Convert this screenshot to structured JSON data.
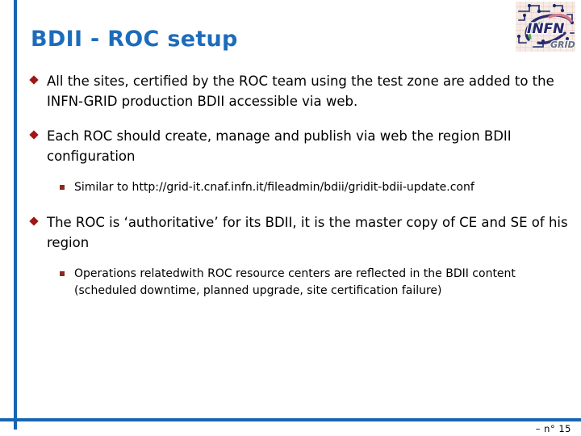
{
  "slide": {
    "title": "BDII - ROC setup",
    "background_color": "#ffffff",
    "accent_color": "#1565b0",
    "title_color": "#1d6cbb",
    "bullet_color": "#9e1616",
    "subbullet_color": "#8a2a1c"
  },
  "logo": {
    "name": "infn-grid-logo",
    "primary_text": "INFN",
    "secondary_text": "GRID",
    "primary_color": "#2b2a6e",
    "secondary_color": "#6b7280"
  },
  "content": {
    "bullets": [
      {
        "level": 1,
        "text": "All the sites,  certified by the ROC team using  the  test zone are  added  to the INFN-GRID  production  BDII accessible via web."
      },
      {
        "level": 1,
        "text": "Each ROC should  create, manage and publish via web the region BDII configuration"
      },
      {
        "level": 2,
        "text": "Similar to http://grid-it.cnaf.infn.it/fileadmin/bdii/gridit-bdii-update.conf"
      },
      {
        "level": 1,
        "text": "The ROC is ‘authoritative’ for its BDII, it  is the master copy of CE and SE of his region"
      },
      {
        "level": 2,
        "text": "Operations relatedwith ROC resource centers are reflected in the BDII content (scheduled downtime, planned upgrade, site certification failure)"
      }
    ]
  },
  "footer": {
    "page_label": "–  n° 15"
  }
}
